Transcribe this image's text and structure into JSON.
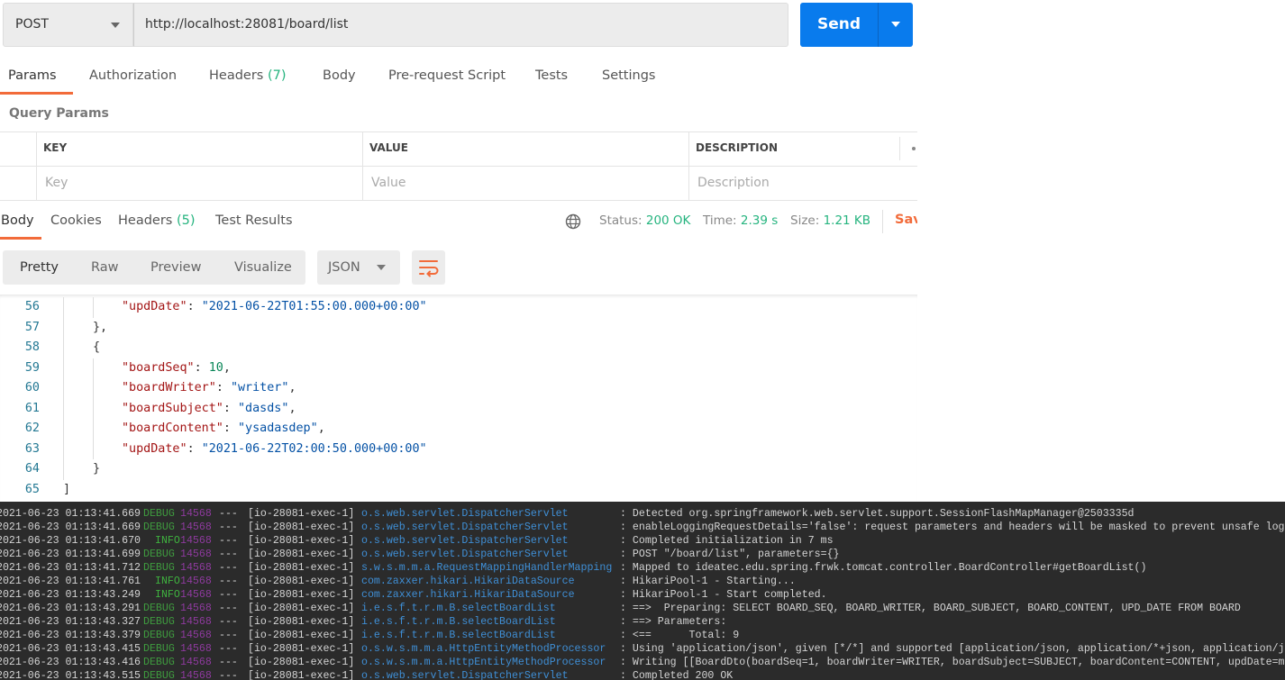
{
  "request": {
    "method": "POST",
    "url": "http://localhost:28081/board/list",
    "send_label": "Send"
  },
  "request_tabs": [
    {
      "label": "Params",
      "active": true
    },
    {
      "label": "Authorization"
    },
    {
      "label": "Headers",
      "count": "(7)"
    },
    {
      "label": "Body"
    },
    {
      "label": "Pre-request Script"
    },
    {
      "label": "Tests"
    },
    {
      "label": "Settings"
    }
  ],
  "query_params": {
    "title": "Query Params",
    "headers": [
      "KEY",
      "VALUE",
      "DESCRIPTION"
    ],
    "placeholders": [
      "Key",
      "Value",
      "Description"
    ]
  },
  "response_tabs": [
    {
      "label": "Body",
      "active": true
    },
    {
      "label": "Cookies"
    },
    {
      "label": "Headers",
      "count": "(5)"
    },
    {
      "label": "Test Results"
    }
  ],
  "status": {
    "status_label": "Status:",
    "status_value": "200 OK",
    "time_label": "Time:",
    "time_value": "2.39 s",
    "size_label": "Size:",
    "size_value": "1.21 KB",
    "save_label": "Save Response"
  },
  "view_modes": [
    "Pretty",
    "Raw",
    "Preview",
    "Visualize"
  ],
  "format": "JSON",
  "colors": {
    "accent": "#f26b3a",
    "send": "#097bed",
    "success": "#26b47f"
  },
  "code_lines": [
    {
      "num": "56",
      "level": 2,
      "tokens": [
        [
          "k",
          "\"updDate\""
        ],
        [
          "p",
          ": "
        ],
        [
          "s",
          "\"2021-06-22T01:55:00.000+00:00\""
        ]
      ]
    },
    {
      "num": "57",
      "level": 1,
      "tokens": [
        [
          "p",
          "},"
        ]
      ]
    },
    {
      "num": "58",
      "level": 1,
      "tokens": [
        [
          "p",
          "{"
        ]
      ]
    },
    {
      "num": "59",
      "level": 2,
      "tokens": [
        [
          "k",
          "\"boardSeq\""
        ],
        [
          "p",
          ": "
        ],
        [
          "n",
          "10"
        ],
        [
          "p",
          ","
        ]
      ]
    },
    {
      "num": "60",
      "level": 2,
      "tokens": [
        [
          "k",
          "\"boardWriter\""
        ],
        [
          "p",
          ": "
        ],
        [
          "s",
          "\"writer\""
        ],
        [
          "p",
          ","
        ]
      ]
    },
    {
      "num": "61",
      "level": 2,
      "tokens": [
        [
          "k",
          "\"boardSubject\""
        ],
        [
          "p",
          ": "
        ],
        [
          "s",
          "\"dasds\""
        ],
        [
          "p",
          ","
        ]
      ]
    },
    {
      "num": "62",
      "level": 2,
      "tokens": [
        [
          "k",
          "\"boardContent\""
        ],
        [
          "p",
          ": "
        ],
        [
          "s",
          "\"ysadasdep\""
        ],
        [
          "p",
          ","
        ]
      ]
    },
    {
      "num": "63",
      "level": 2,
      "tokens": [
        [
          "k",
          "\"updDate\""
        ],
        [
          "p",
          ": "
        ],
        [
          "s",
          "\"2021-06-22T02:00:50.000+00:00\""
        ]
      ]
    },
    {
      "num": "64",
      "level": 1,
      "tokens": [
        [
          "p",
          "}"
        ]
      ]
    },
    {
      "num": "65",
      "level": 0,
      "tokens": [
        [
          "p",
          "]"
        ]
      ]
    }
  ],
  "console": [
    {
      "ts": "2021-06-23 01:13:41.669",
      "level": "DEBUG",
      "pid": "14568",
      "sep": "---",
      "thread": "[io-28081-exec-1]",
      "logger": "o.s.web.servlet.DispatcherServlet",
      "msg": ": Detected org.springframework.web.servlet.support.SessionFlashMapManager@2503335d"
    },
    {
      "ts": "2021-06-23 01:13:41.669",
      "level": "DEBUG",
      "pid": "14568",
      "sep": "---",
      "thread": "[io-28081-exec-1]",
      "logger": "o.s.web.servlet.DispatcherServlet",
      "msg": ": enableLoggingRequestDetails='false': request parameters and headers will be masked to prevent unsafe log"
    },
    {
      "ts": "2021-06-23 01:13:41.670",
      "level": "INFO",
      "pid": "14568",
      "sep": "---",
      "thread": "[io-28081-exec-1]",
      "logger": "o.s.web.servlet.DispatcherServlet",
      "msg": ": Completed initialization in 7 ms"
    },
    {
      "ts": "2021-06-23 01:13:41.699",
      "level": "DEBUG",
      "pid": "14568",
      "sep": "---",
      "thread": "[io-28081-exec-1]",
      "logger": "o.s.web.servlet.DispatcherServlet",
      "msg": ": POST \"/board/list\", parameters={}"
    },
    {
      "ts": "2021-06-23 01:13:41.712",
      "level": "DEBUG",
      "pid": "14568",
      "sep": "---",
      "thread": "[io-28081-exec-1]",
      "logger": "s.w.s.m.m.a.RequestMappingHandlerMapping",
      "msg": ": Mapped to ideatec.edu.spring.frwk.tomcat.controller.BoardController#getBoardList()"
    },
    {
      "ts": "2021-06-23 01:13:41.761",
      "level": "INFO",
      "pid": "14568",
      "sep": "---",
      "thread": "[io-28081-exec-1]",
      "logger": "com.zaxxer.hikari.HikariDataSource",
      "msg": ": HikariPool-1 - Starting..."
    },
    {
      "ts": "2021-06-23 01:13:43.249",
      "level": "INFO",
      "pid": "14568",
      "sep": "---",
      "thread": "[io-28081-exec-1]",
      "logger": "com.zaxxer.hikari.HikariDataSource",
      "msg": ": HikariPool-1 - Start completed."
    },
    {
      "ts": "2021-06-23 01:13:43.291",
      "level": "DEBUG",
      "pid": "14568",
      "sep": "---",
      "thread": "[io-28081-exec-1]",
      "logger": "i.e.s.f.t.r.m.B.selectBoardList",
      "msg": ": ==>  Preparing: SELECT BOARD_SEQ, BOARD_WRITER, BOARD_SUBJECT, BOARD_CONTENT, UPD_DATE FROM BOARD"
    },
    {
      "ts": "2021-06-23 01:13:43.327",
      "level": "DEBUG",
      "pid": "14568",
      "sep": "---",
      "thread": "[io-28081-exec-1]",
      "logger": "i.e.s.f.t.r.m.B.selectBoardList",
      "msg": ": ==> Parameters: "
    },
    {
      "ts": "2021-06-23 01:13:43.379",
      "level": "DEBUG",
      "pid": "14568",
      "sep": "---",
      "thread": "[io-28081-exec-1]",
      "logger": "i.e.s.f.t.r.m.B.selectBoardList",
      "msg": ": <==      Total: 9"
    },
    {
      "ts": "2021-06-23 01:13:43.415",
      "level": "DEBUG",
      "pid": "14568",
      "sep": "---",
      "thread": "[io-28081-exec-1]",
      "logger": "o.s.w.s.m.m.a.HttpEntityMethodProcessor",
      "msg": ": Using 'application/json', given [*/*] and supported [application/json, application/*+json, application/json"
    },
    {
      "ts": "2021-06-23 01:13:43.416",
      "level": "DEBUG",
      "pid": "14568",
      "sep": "---",
      "thread": "[io-28081-exec-1]",
      "logger": "o.s.w.s.m.m.a.HttpEntityMethodProcessor",
      "msg": ": Writing [[BoardDto(boardSeq=1, boardWriter=WRITER, boardSubject=SUBJECT, boardContent=CONTENT, updDate=m"
    },
    {
      "ts": "2021-06-23 01:13:43.515",
      "level": "DEBUG",
      "pid": "14568",
      "sep": "---",
      "thread": "[io-28081-exec-1]",
      "logger": "o.s.web.servlet.DispatcherServlet",
      "msg": ": Completed 200 OK"
    }
  ]
}
